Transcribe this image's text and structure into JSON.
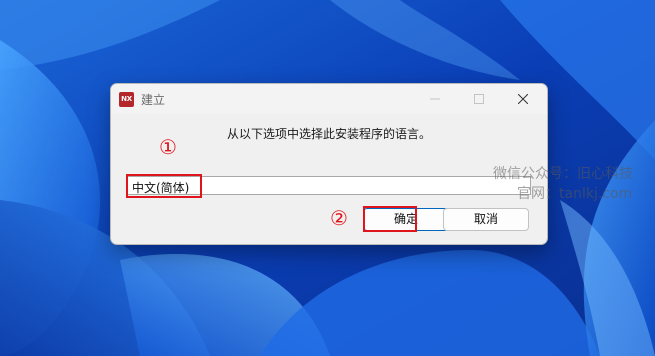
{
  "dialog": {
    "title": "建立",
    "app_icon_text": "NX",
    "instruction": "从以下选项中选择此安装程序的语言。",
    "language_selected": "中文(简体)",
    "ok_label": "确定",
    "cancel_label": "取消"
  },
  "annotations": {
    "step1": "①",
    "step2": "②",
    "highlight_color": "#e0141b"
  },
  "watermark": {
    "line1": "微信公众号：旧心科技",
    "line2": "官网：tanlkj.com"
  },
  "icons": [
    "minimize-icon",
    "maximize-icon",
    "close-icon"
  ]
}
